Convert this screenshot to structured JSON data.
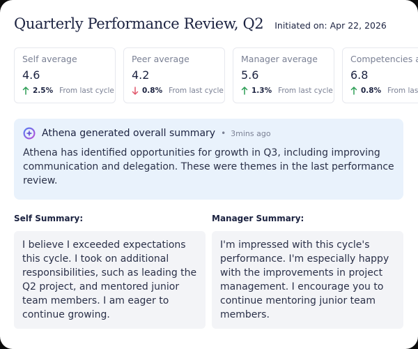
{
  "header": {
    "title": "Quarterly Performance Review, Q2",
    "initiated": "Initiated on: Apr 22, 2026"
  },
  "stats": [
    {
      "label": "Self average",
      "value": "4.6",
      "change": "2.5%",
      "direction": "up",
      "note": "From last cycle"
    },
    {
      "label": "Peer average",
      "value": "4.2",
      "change": "0.8%",
      "direction": "down",
      "note": "From last cycle"
    },
    {
      "label": "Manager average",
      "value": "5.6",
      "change": "1.3%",
      "direction": "up",
      "note": "From last cycle"
    },
    {
      "label": "Competencies average",
      "value": "6.8",
      "change": "0.8%",
      "direction": "up",
      "note": "From last cycle"
    }
  ],
  "summary": {
    "icon": "athena-sparkle-icon",
    "title": "Athena generated overall summary",
    "separator": "•",
    "time": "3mins ago",
    "text": "Athena has identified opportunities for growth in Q3, including improving communication and delegation. These were themes in the last performance review."
  },
  "self_summary": {
    "label": "Self Summary:",
    "text": "I believe I exceeded expectations this cycle. I took on additional responsibilities, such as leading the Q2 project, and mentored junior team members. I am eager to continue growing."
  },
  "manager_summary": {
    "label": "Manager Summary:",
    "text": "I'm impressed with this cycle's performance. I'm especially happy with the improvements in project management. I encourage you to continue mentoring junior team members."
  },
  "colors": {
    "up": "#2e9e56",
    "down": "#e0566a",
    "summary_bg": "#e9f2fc",
    "title": "#1b2240"
  }
}
